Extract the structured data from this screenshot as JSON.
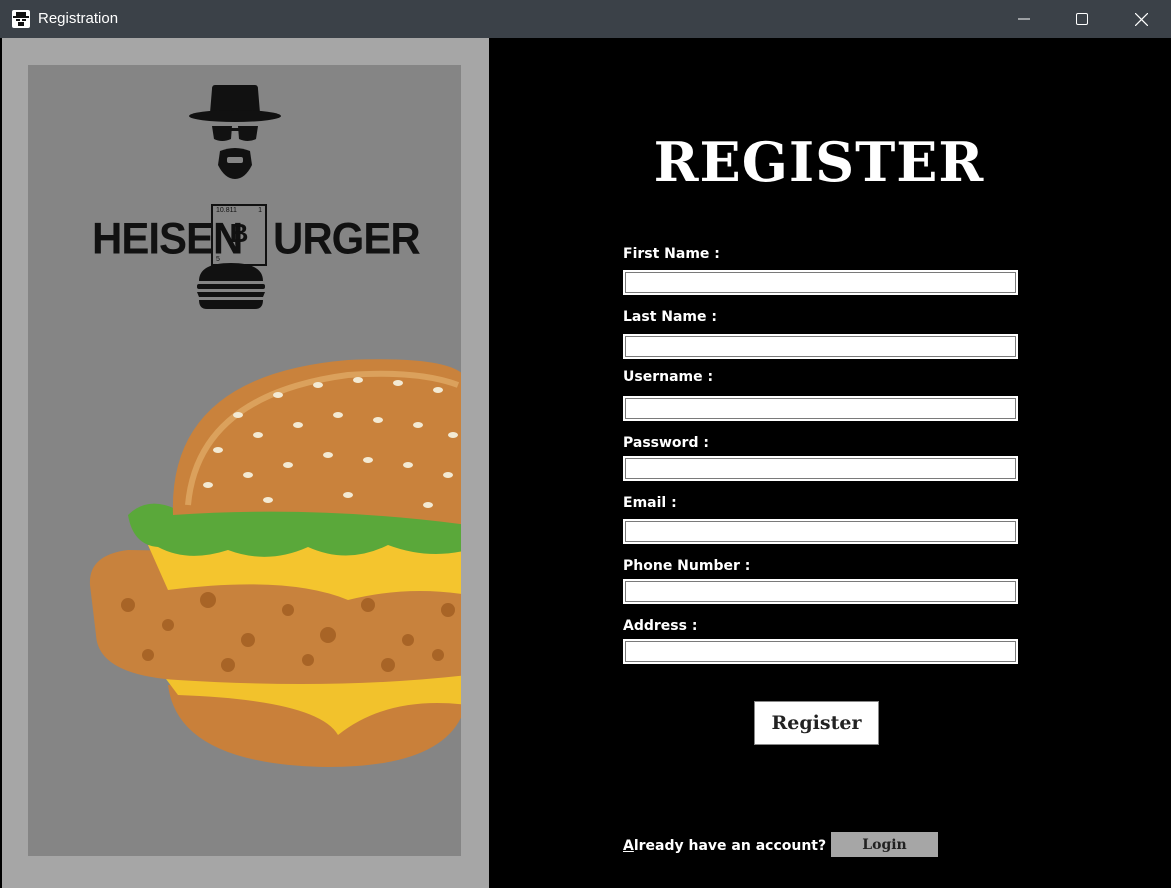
{
  "window": {
    "title": "Registration"
  },
  "brand": {
    "left": "HEISEN",
    "symbol": "B",
    "right": "URGER",
    "atomic_mass": "10.811",
    "corner_num": "1",
    "atomic_number": "5"
  },
  "form": {
    "heading": "REGISTER",
    "fields": [
      {
        "label": "First Name :",
        "value": ""
      },
      {
        "label": "Last Name :",
        "value": ""
      },
      {
        "label": "Username :",
        "value": ""
      },
      {
        "label": "Password :",
        "value": ""
      },
      {
        "label": "Email :",
        "value": ""
      },
      {
        "label": "Phone Number :",
        "value": ""
      },
      {
        "label": "Address :",
        "value": ""
      }
    ],
    "register_label": "Register",
    "already_text": "Already have an account?",
    "login_label": "Login"
  },
  "colors": {
    "titlebar": "#3b4148",
    "left_panel": "#a6a6a6",
    "left_inner": "#858585",
    "right_panel": "#000000",
    "login_button": "#a6a6a6"
  },
  "icons": {
    "app": "heisenberg-icon",
    "minimize": "minimize-icon",
    "maximize": "maximize-icon",
    "close": "close-icon"
  }
}
